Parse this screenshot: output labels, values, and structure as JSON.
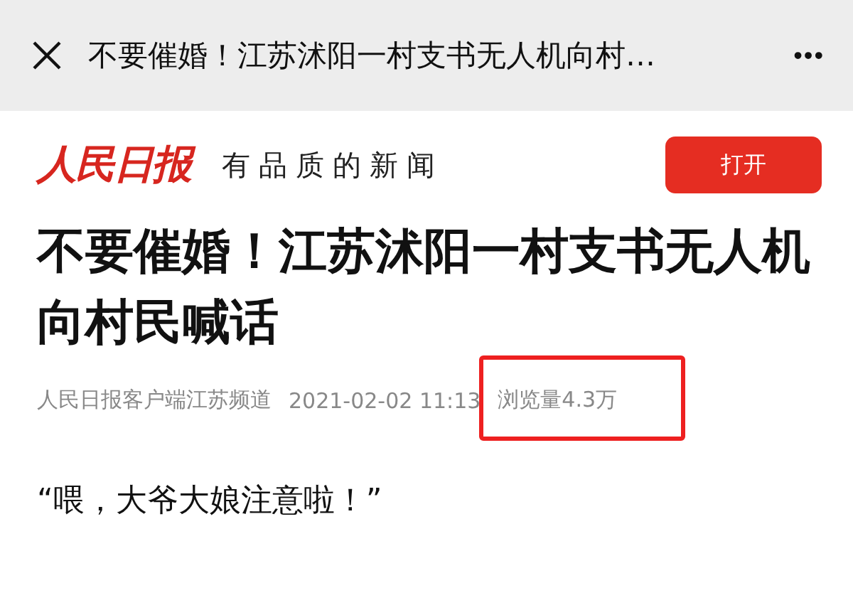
{
  "top_bar": {
    "title": "不要催婚！江苏沭阳一村支书无人机向村…",
    "more": "•••"
  },
  "banner": {
    "logo": "人民日报",
    "slogan": "有品质的新闻",
    "button": "打开"
  },
  "article": {
    "headline": "不要催婚！江苏沭阳一村支书无人机向村民喊话",
    "source": "人民日报客户端江苏频道",
    "time": "2021-02-02 11:13",
    "views": {
      "text": "浏览量4.3万",
      "highlighted": true
    },
    "first_line": "“喂，大爷大娘注意啦！”"
  }
}
